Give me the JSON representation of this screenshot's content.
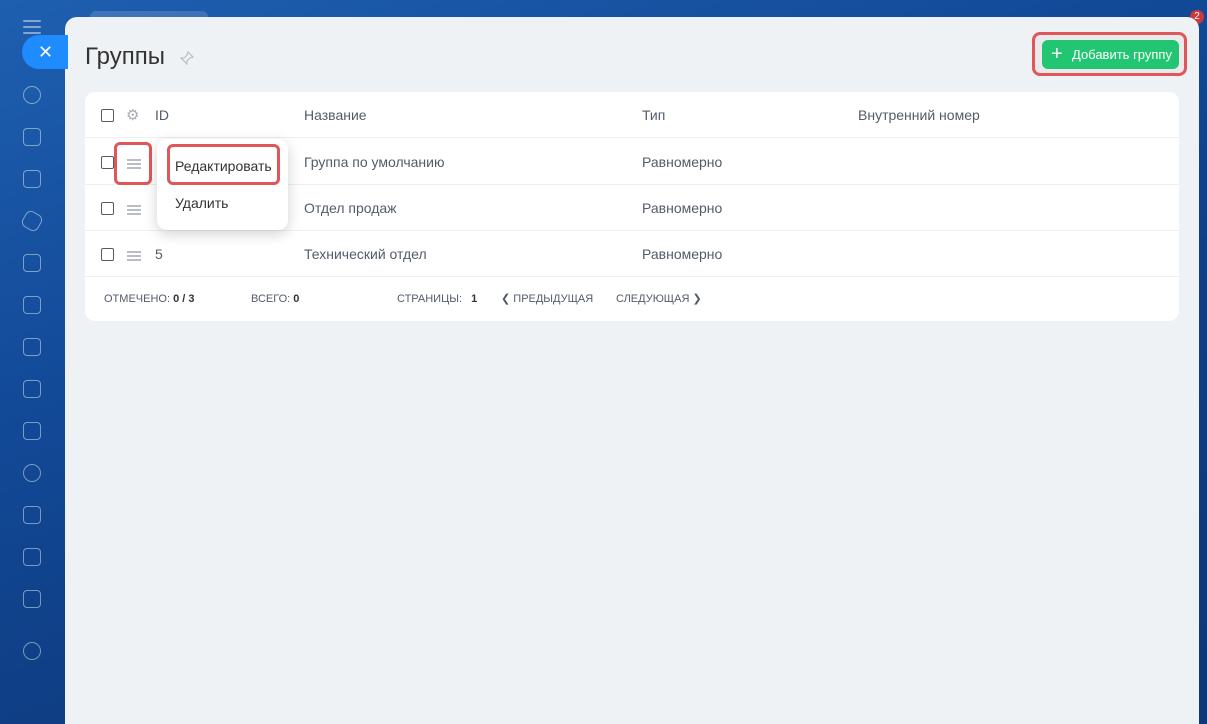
{
  "header": {
    "title": "Группы",
    "add_button_label": "Добавить группу",
    "notification_count": "2"
  },
  "table": {
    "columns": [
      "ID",
      "Название",
      "Тип",
      "Внутренний номер"
    ],
    "rows": [
      {
        "id": "",
        "name": "Группа по умолчанию",
        "type": "Равномерно",
        "internal": ""
      },
      {
        "id": "",
        "name": "Отдел продаж",
        "type": "Равномерно",
        "internal": ""
      },
      {
        "id": "5",
        "name": "Технический отдел",
        "type": "Равномерно",
        "internal": ""
      }
    ]
  },
  "footer": {
    "marked_label": "ОТМЕЧЕНО:",
    "marked_value": "0 / 3",
    "total_label": "ВСЕГО:",
    "total_value": "0",
    "pages_label": "СТРАНИЦЫ:",
    "pages_value": "1",
    "prev_label": "ПРЕДЫДУЩАЯ",
    "next_label": "СЛЕДУЮЩАЯ"
  },
  "context_menu": {
    "items": [
      "Редактировать",
      "Удалить"
    ]
  },
  "colors": {
    "accent_green": "#22c672",
    "highlight_red": "#e0575a",
    "close_blue": "#1e8bff"
  }
}
